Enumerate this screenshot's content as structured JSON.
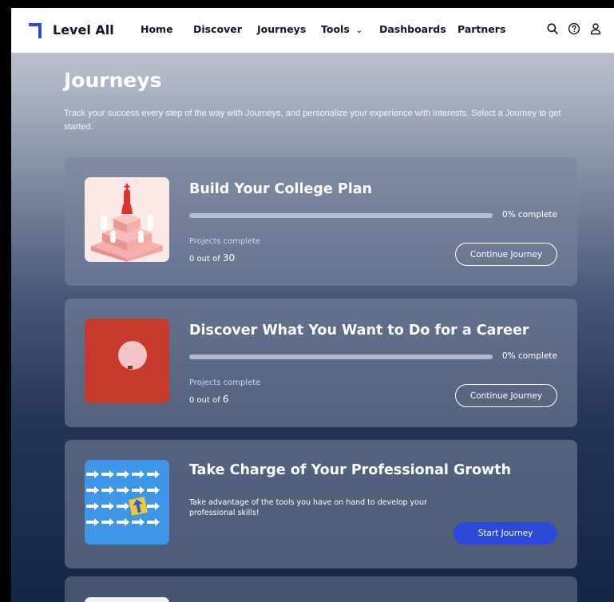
{
  "nav": {
    "brand": "Level All",
    "items": [
      "Home",
      "Discover",
      "Journeys",
      "Tools",
      "Dashboards",
      "Partners"
    ],
    "tools_chevron": "⌄",
    "icons": [
      "search-icon",
      "help-icon",
      "user-icon"
    ],
    "accent_color": "#2d49d9"
  },
  "header": {
    "title": "Journeys",
    "description": "Track your success every step of the way with Journeys, and personalize your experience with interests. Select a Journey to get started."
  },
  "journeys": [
    {
      "title": "Build Your College Plan",
      "progress": 0,
      "progress_label": "0% complete",
      "projects_label": "Projects complete",
      "count_prefix": "0 out of ",
      "count_total": "30",
      "button": "Continue Journey",
      "image": "chess-king-illustration"
    },
    {
      "title": "Discover What You Want to Do for a Career",
      "progress": 0,
      "progress_label": "0% complete",
      "projects_label": "Projects complete",
      "count_prefix": "0 out of ",
      "count_total": "6",
      "button": "Continue Journey",
      "image": "sunset-circle-illustration"
    },
    {
      "title": "Take Charge of Your Professional Growth",
      "description": "Take advantage of the tools you have on hand to develop your professional skills!",
      "button": "Start Journey",
      "image": "arrows-pattern-illustration"
    }
  ]
}
